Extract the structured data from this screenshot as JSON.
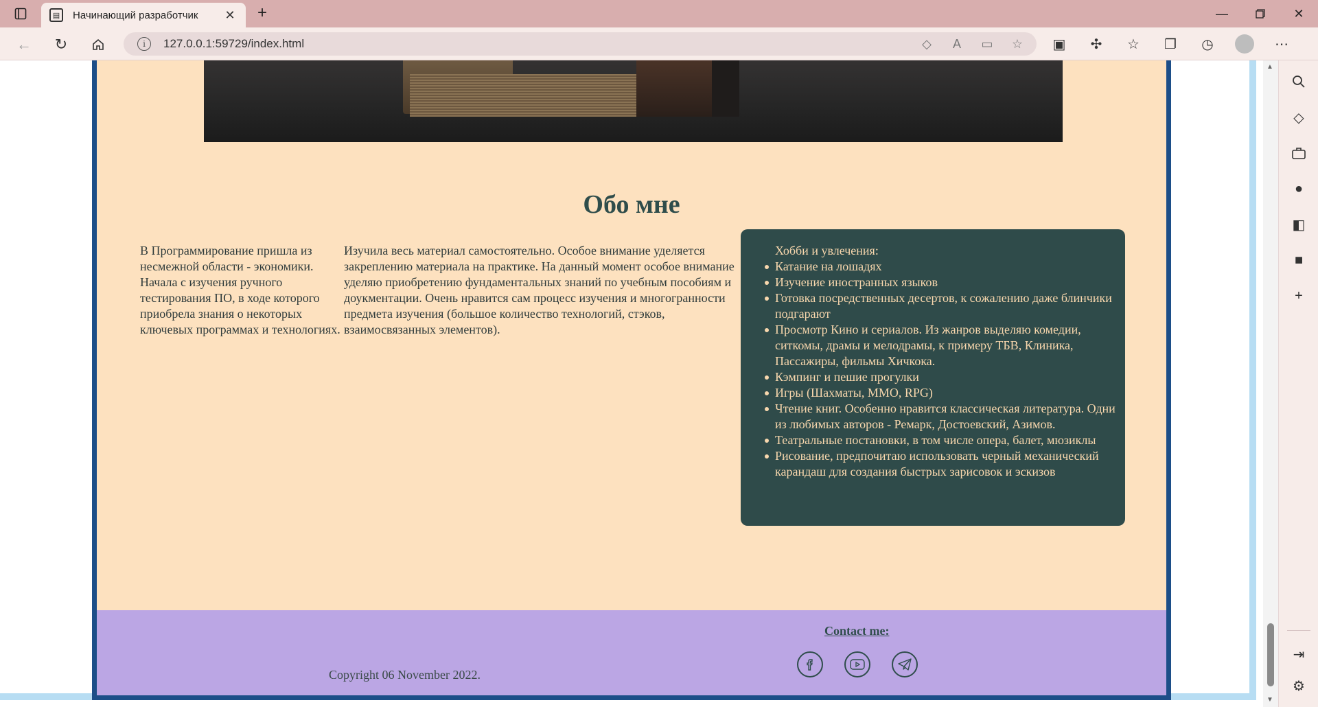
{
  "browser": {
    "tab_title": "Начинающий разработчик",
    "url": "127.0.0.1:59729/index.html"
  },
  "page": {
    "about_title": "Обо мне",
    "column1": "В Программирование пришла из несмежной области - экономики. Начала с изучения ручного тестирования ПО, в ходе которого приобрела знания о некоторых ключевых программах и технологиях.",
    "column2": "Изучила весь материал самостоятельно. Особое внимание уделяется закреплению материала на практике. На данный момент особое внимание уделяю приобретению фундаментальных знаний по учебным пособиям и доукментации. Очень нравится сам процесс изучения и многогранности предмета изучения (большое количество технологий, стэков, взаимосвязанных элементов).",
    "hobbies_title": "Хобби и увлечения:",
    "hobbies": [
      "Катание на лошадях",
      "Изучение иностранных языков",
      "Готовка посредственных десертов, к сожалению даже блинчики подгарают",
      "Просмотр Кино и сериалов. Из жанров выделяю комедии, ситкомы, драмы и мелодрамы, к примеру ТБВ, Клиника, Пассажиры, фильмы Хичкока.",
      "Кэмпинг и пешие прогулки",
      "Игры (Шахматы, ММО, RPG)",
      "Чтение книг. Особенно нравится классическая литература. Одни из любимых авторов - Ремарк, Достоевский, Азимов.",
      "Театральные постановки, в том числе опера, балет, мюзиклы",
      "Рисование, предпочитаю использовать черный механический карандаш для создания быстрых зарисовок и эскизов"
    ]
  },
  "footer": {
    "copyright": "Copyright 06 November 2022.",
    "contact_title": "Contact me:"
  },
  "colors": {
    "page_bg": "#fde1bf",
    "accent_dark": "#2f4b4a",
    "footer_bg": "#bba6e4",
    "border_blue": "#1c4e88"
  }
}
